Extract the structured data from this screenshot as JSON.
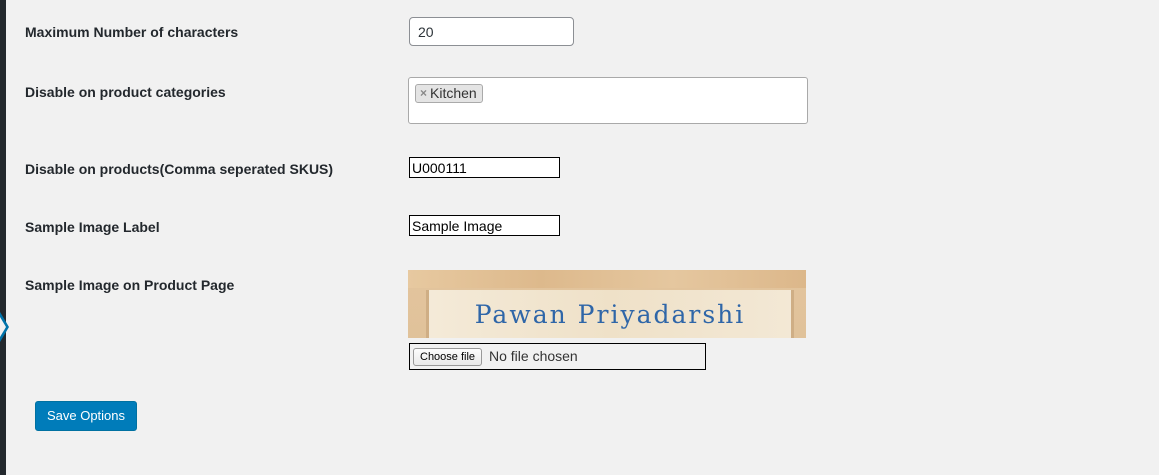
{
  "fields": {
    "max_chars": {
      "label": "Maximum Number of characters",
      "value": "20"
    },
    "disable_categories": {
      "label": "Disable on product categories",
      "chips": [
        "Kitchen"
      ],
      "remove_glyph": "×"
    },
    "disable_products": {
      "label": "Disable on products(Comma seperated SKUS)",
      "value": "U000111"
    },
    "sample_label": {
      "label": "Sample Image Label",
      "value": "Sample Image"
    },
    "sample_image": {
      "label": "Sample Image on Product Page",
      "image_text": "Pawan Priyadarshi",
      "choose_button": "Choose file",
      "file_status": "No file chosen"
    }
  },
  "actions": {
    "save_label": "Save Options"
  },
  "colors": {
    "primary": "#007cba",
    "background": "#f1f1f1",
    "sidebar": "#23282d"
  }
}
